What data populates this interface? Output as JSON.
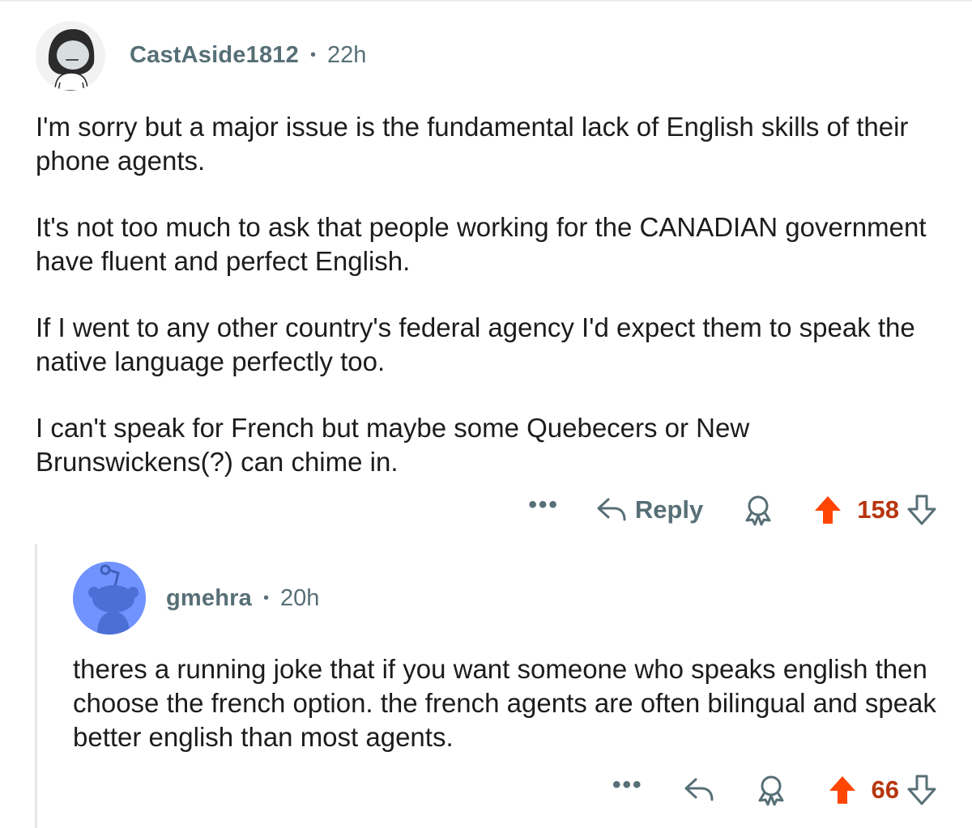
{
  "comments": [
    {
      "username": "CastAside1812",
      "separator": "•",
      "time": "22h",
      "paragraphs": [
        "I'm sorry but a major issue is the fundamental lack of English skills of their phone agents.",
        "It's not too much to ask that people working for the CANADIAN government have fluent and perfect English.",
        "If I went to any other country's federal agency I'd expect them to speak the native language perfectly too.",
        "I can't speak for French but maybe some Quebecers or New Brunswickens(?) can chime in."
      ],
      "actions": {
        "more_label": "•••",
        "reply_label": "Reply",
        "score": "158"
      }
    },
    {
      "username": "gmehra",
      "separator": "•",
      "time": "20h",
      "paragraphs": [
        "theres a running joke that if you want someone who speaks english then choose the french option. the french agents are often bilingual and speak better english than most agents."
      ],
      "actions": {
        "more_label": "•••",
        "score": "66"
      }
    }
  ],
  "icons": {
    "reply": "reply-arrow-icon",
    "award": "award-icon",
    "upvote": "upvote-arrow-icon",
    "downvote": "downvote-arrow-icon",
    "more": "more-dots-icon"
  },
  "colors": {
    "upvote_active": "#ff4500",
    "score_active": "#b7350e",
    "meta_text": "#576f76",
    "avatar2_bg": "#7193ff",
    "thread_line": "#e8e8e8"
  }
}
